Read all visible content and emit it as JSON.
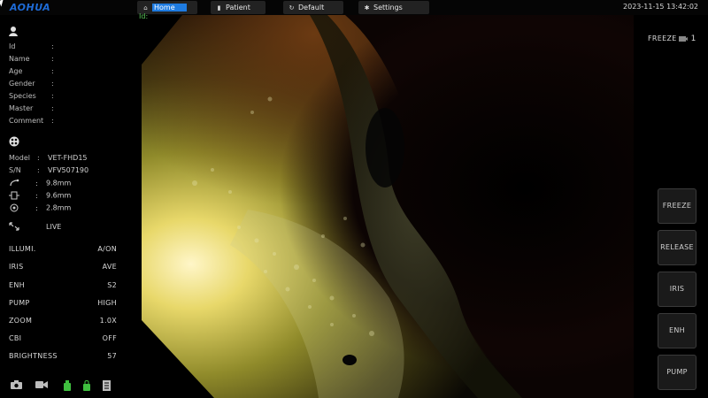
{
  "topbar": {
    "logo": "AOHUA",
    "menu": [
      {
        "icon": "home-icon",
        "label": "Home"
      },
      {
        "icon": "lock-icon",
        "label": "Patient"
      },
      {
        "icon": "refresh-icon",
        "label": "Default"
      },
      {
        "icon": "gear-icon",
        "label": "Settings"
      }
    ],
    "datetime": "2023-11-15 13:42:02"
  },
  "overlay": {
    "id_label": "Id:"
  },
  "patient": {
    "icon": "user-icon",
    "fields": [
      {
        "label": "Id",
        "sep": ":",
        "value": ""
      },
      {
        "label": "Name",
        "sep": ":",
        "value": ""
      },
      {
        "label": "Age",
        "sep": ":",
        "value": ""
      },
      {
        "label": "Gender",
        "sep": ":",
        "value": ""
      },
      {
        "label": "Species",
        "sep": ":",
        "value": ""
      },
      {
        "label": "Master",
        "sep": ":",
        "value": ""
      },
      {
        "label": "Comment",
        "sep": ":",
        "value": ""
      }
    ]
  },
  "scope": {
    "icon": "scope-icon",
    "model_label": "Model",
    "model_sep": ":",
    "model_value": "VET-FHD15",
    "sn_label": "S/N",
    "sn_sep": ":",
    "sn_value": "VFV507190",
    "dims": [
      {
        "icon": "insertion-diameter-icon",
        "sep": ":",
        "value": "9.8mm"
      },
      {
        "icon": "tip-diameter-icon",
        "sep": ":",
        "value": "9.6mm"
      },
      {
        "icon": "channel-diameter-icon",
        "sep": ":",
        "value": "2.8mm"
      }
    ],
    "live_icon": "fullscreen-icon",
    "live": "LIVE"
  },
  "params": [
    {
      "label": "ILLUMI.",
      "value": "A/ON"
    },
    {
      "label": "IRIS",
      "value": "AVE"
    },
    {
      "label": "ENH",
      "value": "S2"
    },
    {
      "label": "PUMP",
      "value": "HIGH"
    },
    {
      "label": "ZOOM",
      "value": "1.0X"
    },
    {
      "label": "CBI",
      "value": "OFF"
    },
    {
      "label": "BRIGHTNESS",
      "value": "57"
    }
  ],
  "bottom_icons": [
    "camera-icon",
    "video-camera-icon",
    "storage-green-icon",
    "storage-lock-icon",
    "report-icon"
  ],
  "freeze_tag": {
    "label": "FREEZE",
    "icon": "camera-icon",
    "count": "1"
  },
  "right_buttons": [
    "FREEZE",
    "RELEASE",
    "IRIS",
    "ENH",
    "PUMP"
  ],
  "colors": {
    "accent": "#1e7be0",
    "logo": "#1e6bd6",
    "status_green": "#5ac85a"
  }
}
